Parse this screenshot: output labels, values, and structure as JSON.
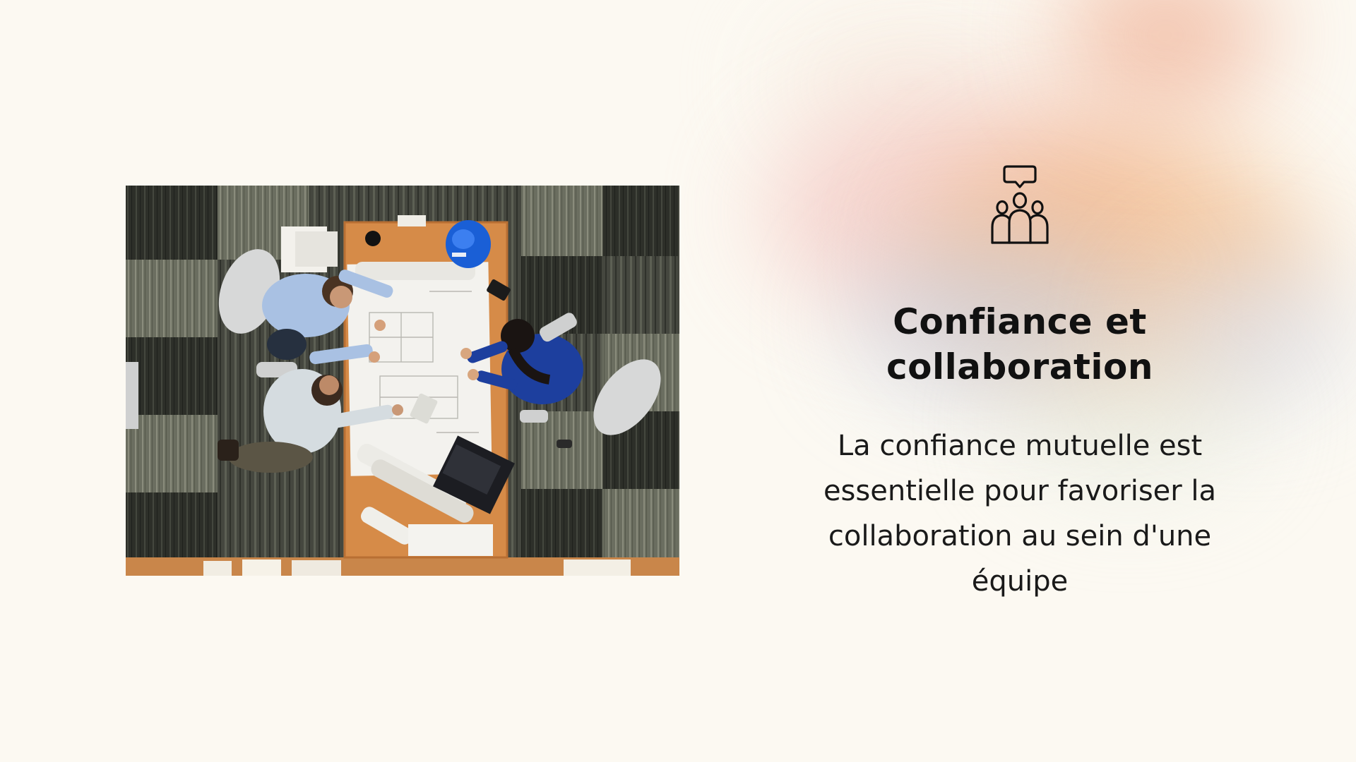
{
  "slide": {
    "icon": "team-communication-icon",
    "title": "Confiance et collaboration",
    "body": "La confiance mutuelle est essentielle pour favoriser la collaboration au sein d'une équipe",
    "photo": "team-meeting-photo",
    "colors": {
      "background": "#fcf9f2",
      "text": "#111111",
      "gradient_pink": "#f4c9c4",
      "gradient_orange": "#f3b884",
      "gradient_blue": "#c6d3e6"
    }
  }
}
